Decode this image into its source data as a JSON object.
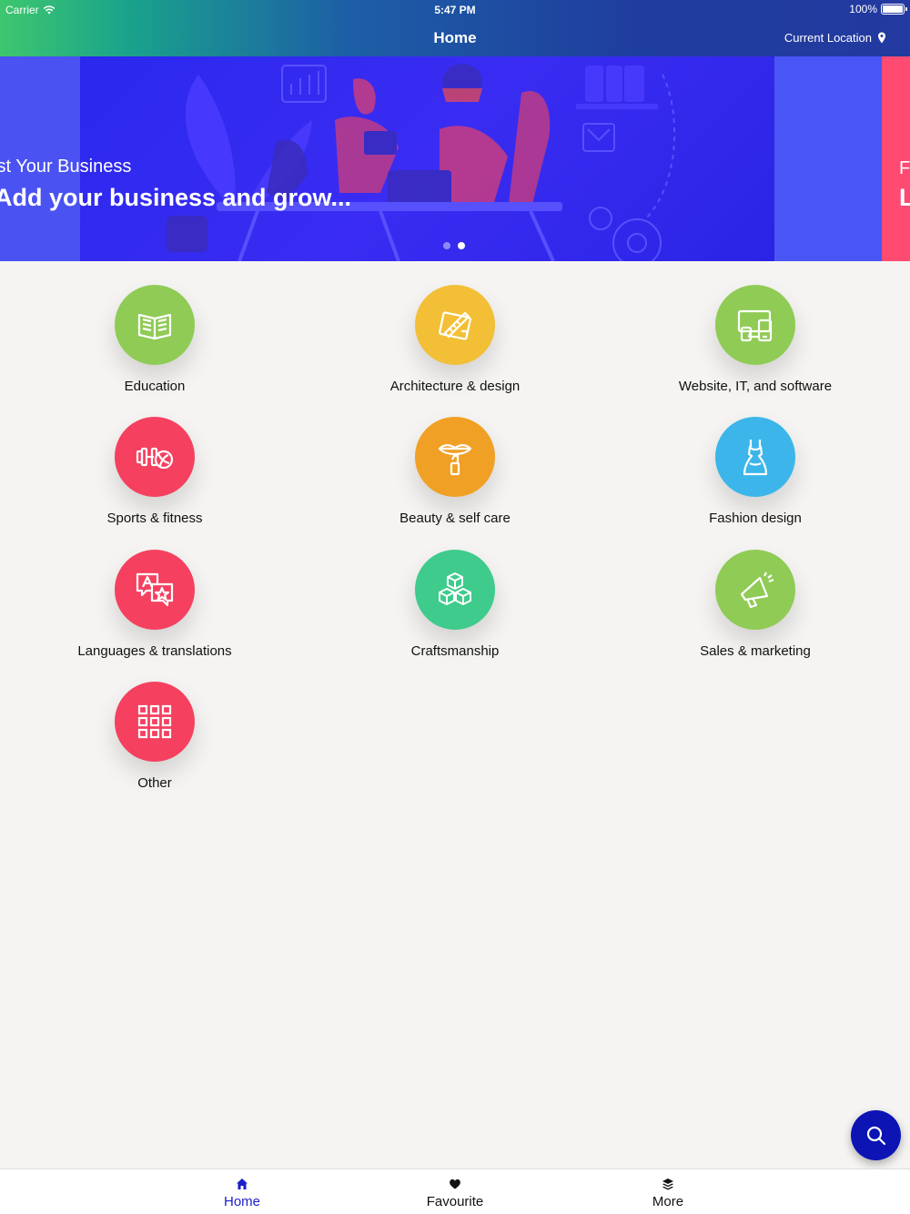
{
  "status_bar": {
    "carrier": "Carrier",
    "time": "5:47 PM",
    "battery": "100%"
  },
  "nav": {
    "title": "Home",
    "location": "Current Location"
  },
  "banner": {
    "subtitle": "ist Your Business",
    "headline": "Add your business and grow...",
    "next_slide_subtitle": "F",
    "next_slide_headline": "L",
    "page_count": 2,
    "active_page": 2
  },
  "categories": [
    {
      "label": "Education",
      "color": "#8fcb55",
      "icon": "book-icon"
    },
    {
      "label": "Architecture & design",
      "color": "#f2bf36",
      "icon": "drafting-icon"
    },
    {
      "label": "Website, IT, and software",
      "color": "#8fcb55",
      "icon": "devices-icon"
    },
    {
      "label": "Sports & fitness",
      "color": "#f5405f",
      "icon": "dumbbell-icon"
    },
    {
      "label": "Beauty & self care",
      "color": "#f0a024",
      "icon": "lipstick-icon"
    },
    {
      "label": "Fashion design",
      "color": "#3cb6ea",
      "icon": "dress-icon"
    },
    {
      "label": "Languages & translations",
      "color": "#f5405f",
      "icon": "translate-icon"
    },
    {
      "label": "Craftsmanship",
      "color": "#3ecb8c",
      "icon": "cubes-icon"
    },
    {
      "label": "Sales & marketing",
      "color": "#8fcb55",
      "icon": "megaphone-icon"
    },
    {
      "label": "Other",
      "color": "#f5405f",
      "icon": "grid-icon"
    }
  ],
  "tabs": [
    {
      "label": "Home",
      "icon": "home-icon",
      "active": true
    },
    {
      "label": "Favourite",
      "icon": "heart-icon",
      "active": false
    },
    {
      "label": "More",
      "icon": "layers-icon",
      "active": false
    }
  ],
  "colors": {
    "accent": "#1a1fc8",
    "fab": "#0d14b4"
  }
}
